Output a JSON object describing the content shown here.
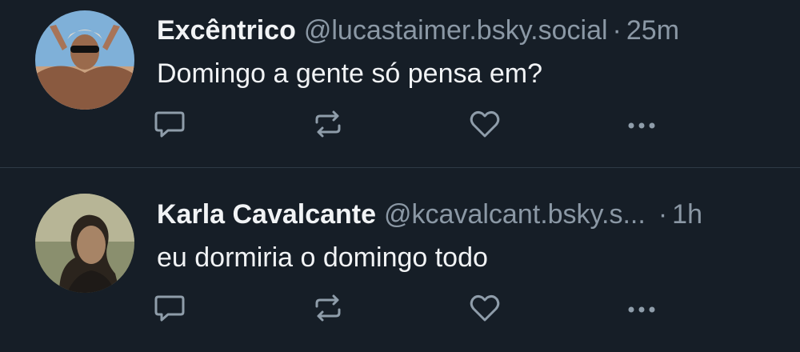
{
  "posts": [
    {
      "author_name": "Excêntrico",
      "handle": "@lucastaimer.bsky.social",
      "separator": "·",
      "time": "25m",
      "text": "Domingo a gente só pensa em?",
      "avatar_icon": "avatar-man-sunglasses"
    },
    {
      "author_name": "Karla Cavalcante",
      "handle": "@kcavalcant.bsky.s...",
      "separator": "·",
      "time": "1h",
      "text": "eu dormiria o domingo todo",
      "avatar_icon": "avatar-woman-profile"
    }
  ],
  "actions": {
    "reply_icon": "reply-icon",
    "repost_icon": "repost-icon",
    "like_icon": "heart-icon",
    "more_icon": "more-icon"
  },
  "colors": {
    "background": "#161e27",
    "text": "#f1f3f5",
    "muted": "#8b98a5",
    "icon": "#8f9daa",
    "divider": "#2e3a46"
  }
}
